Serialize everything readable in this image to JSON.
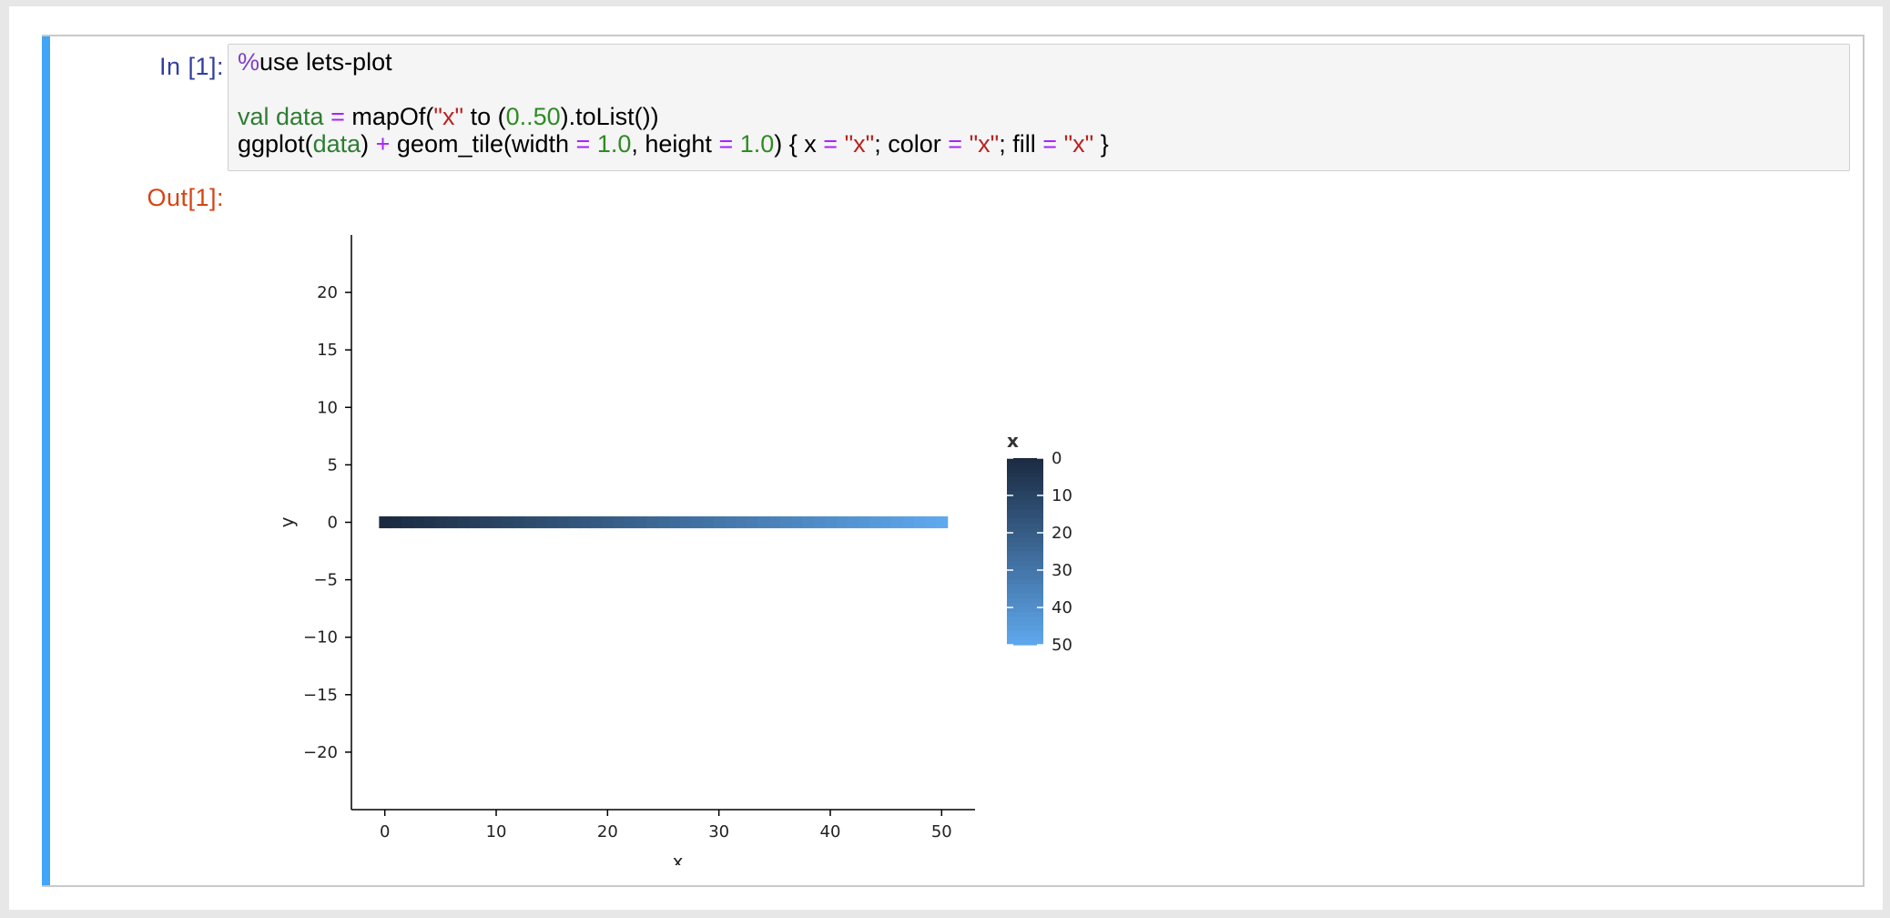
{
  "cell": {
    "in_prompt": "In [1]:",
    "out_prompt": "Out[1]:",
    "code_line1": [
      "%",
      "use lets-plot"
    ],
    "code_line2": [
      "val data",
      " = ",
      "mapOf(",
      "\"x\"",
      " to (",
      "0..50",
      ").toList())"
    ],
    "code_line3": [
      "ggplot(",
      "data",
      ") ",
      "+",
      " geom_tile(width ",
      "=",
      " ",
      "1.0",
      ", height ",
      "=",
      " ",
      "1.0",
      ") { x ",
      "=",
      " ",
      "\"x\"",
      "; color ",
      "=",
      " ",
      "\"x\"",
      "; fill ",
      "=",
      " ",
      "\"x\"",
      " }"
    ]
  },
  "chart_data": {
    "type": "heatmap",
    "x": [
      0,
      1,
      2,
      3,
      4,
      5,
      6,
      7,
      8,
      9,
      10,
      11,
      12,
      13,
      14,
      15,
      16,
      17,
      18,
      19,
      20,
      21,
      22,
      23,
      24,
      25,
      26,
      27,
      28,
      29,
      30,
      31,
      32,
      33,
      34,
      35,
      36,
      37,
      38,
      39,
      40,
      41,
      42,
      43,
      44,
      45,
      46,
      47,
      48,
      49,
      50
    ],
    "y_value": 0,
    "tile_width": 1.0,
    "tile_height": 1.0,
    "xlabel": "x",
    "ylabel": "y",
    "xlim": [
      -3,
      53
    ],
    "ylim": [
      -25,
      25
    ],
    "x_ticks": [
      "0",
      "10",
      "20",
      "30",
      "40",
      "50"
    ],
    "y_ticks": [
      "20",
      "15",
      "10",
      "5",
      "0",
      "−5",
      "−10",
      "−15",
      "−20"
    ],
    "legend": {
      "title": "x",
      "placement": "right",
      "labels": [
        "0",
        "10",
        "20",
        "30",
        "40",
        "50"
      ],
      "color_low": "#1b2a40",
      "color_high": "#5fa8ee"
    }
  }
}
